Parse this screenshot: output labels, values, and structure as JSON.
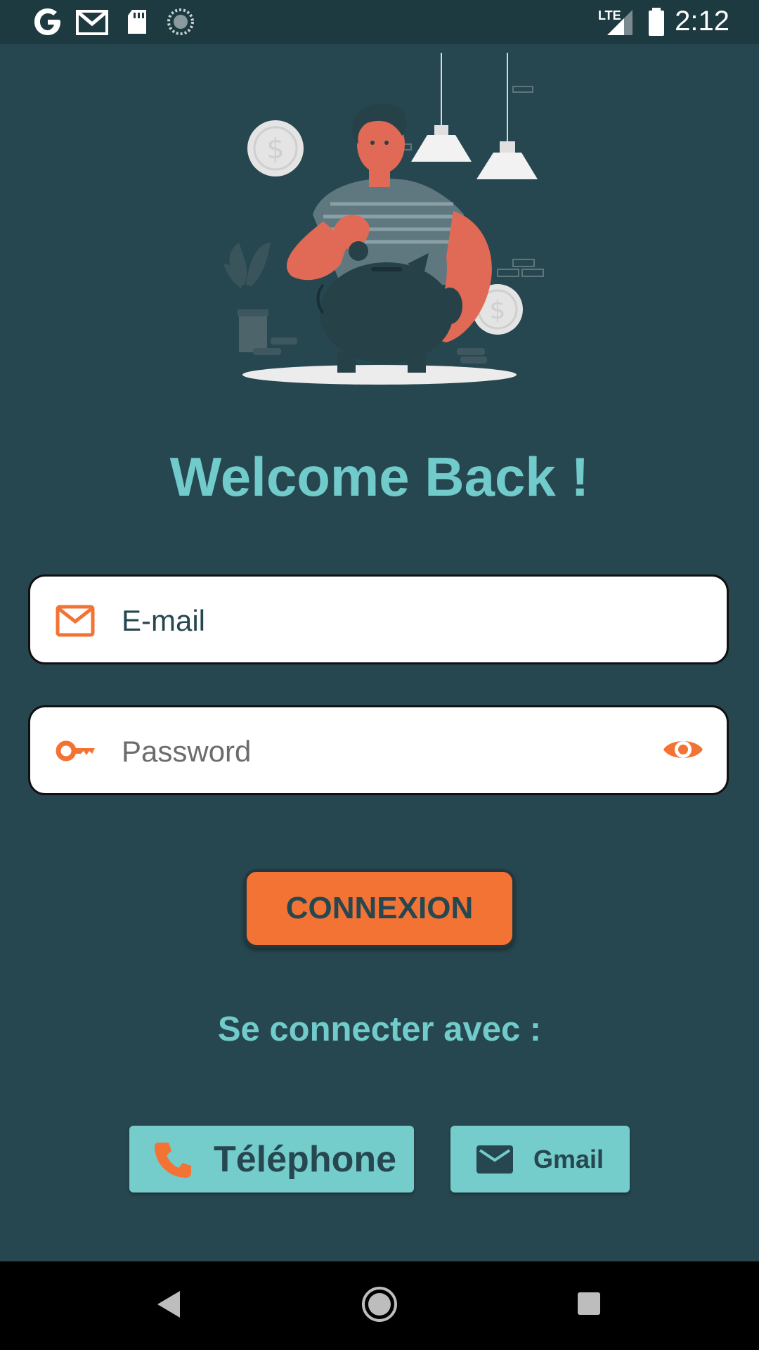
{
  "status_bar": {
    "time": "2:12",
    "network_label": "LTE",
    "icons": [
      "google-icon",
      "gmail-icon",
      "sd-card-icon",
      "sync-icon",
      "signal-icon",
      "battery-icon"
    ]
  },
  "illustration": {
    "coin_symbol": "$",
    "description_icon": "piggy-bank-illustration"
  },
  "login": {
    "title": "Welcome Back !",
    "email_placeholder": "E-mail",
    "password_placeholder": "Password",
    "submit_label": "CONNEXION",
    "connect_with_label": "Se connecter avec :"
  },
  "social": {
    "phone_label": "Téléphone",
    "gmail_label": "Gmail"
  },
  "colors": {
    "background": "#274750",
    "accent_teal": "#72cbcb",
    "accent_orange": "#f37335",
    "status_bar": "#1e3a41"
  }
}
